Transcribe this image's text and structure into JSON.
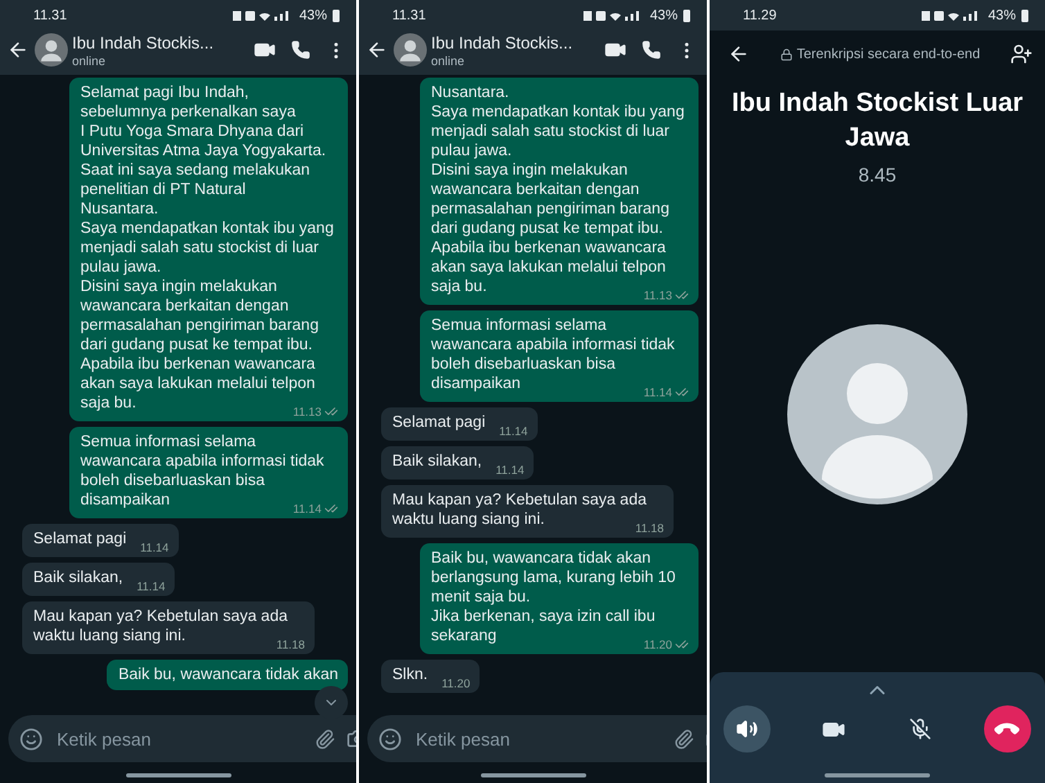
{
  "screens": [
    {
      "kind": "chat",
      "status_bar": {
        "time": "11.31",
        "battery": "43%"
      },
      "header": {
        "name": "Ibu Indah Stockis...",
        "status": "online"
      },
      "messages": [
        {
          "kind": "sent",
          "text": "Selamat pagi Ibu Indah,\nsebelumnya perkenalkan saya\nI Putu Yoga Smara Dhyana dari Universitas Atma Jaya Yogyakarta.\nSaat ini saya sedang melakukan penelitian di PT Natural\nNusantara.\nSaya mendapatkan kontak ibu yang menjadi salah satu stockist di luar pulau jawa.\nDisini saya ingin melakukan wawancara berkaitan dengan permasalahan pengiriman barang dari gudang pusat ke tempat ibu.\nApabila ibu berkenan wawancara akan saya lakukan melalui telpon saja bu.",
          "time": "11.13"
        },
        {
          "kind": "sent",
          "text": "Semua informasi selama wawancara apabila informasi tidak boleh disebarluaskan bisa disampaikan",
          "time": "11.14"
        },
        {
          "kind": "received",
          "text": "Selamat pagi",
          "time": "11.14"
        },
        {
          "kind": "received",
          "text": "Baik silakan,",
          "time": "11.14"
        },
        {
          "kind": "received",
          "text": "Mau kapan ya? Kebetulan saya ada waktu luang siang ini.",
          "time": "11.18"
        },
        {
          "kind": "sent",
          "text": "Baik bu, wawancara tidak akan"
        }
      ],
      "scroll_down_button": true,
      "composer": {
        "placeholder": "Ketik pesan"
      }
    },
    {
      "kind": "chat",
      "status_bar": {
        "time": "11.31",
        "battery": "43%"
      },
      "header": {
        "name": "Ibu Indah Stockis...",
        "status": "online"
      },
      "messages": [
        {
          "kind": "sent",
          "text": "Nusantara.\nSaya mendapatkan kontak ibu yang menjadi salah satu stockist di luar pulau jawa.\nDisini saya ingin melakukan wawancara berkaitan dengan permasalahan pengiriman barang dari gudang pusat ke tempat ibu.\nApabila ibu berkenan wawancara akan saya lakukan melalui telpon saja bu.",
          "time": "11.13"
        },
        {
          "kind": "sent",
          "text": "Semua informasi selama wawancara apabila informasi tidak boleh disebarluaskan bisa disampaikan",
          "time": "11.14"
        },
        {
          "kind": "received",
          "text": "Selamat pagi",
          "time": "11.14"
        },
        {
          "kind": "received",
          "text": "Baik silakan,",
          "time": "11.14"
        },
        {
          "kind": "received",
          "text": "Mau kapan ya? Kebetulan saya ada waktu luang siang ini.",
          "time": "11.18"
        },
        {
          "kind": "sent",
          "text": "Baik bu, wawancara tidak akan berlangsung lama, kurang lebih 10 menit saja bu.\nJika berkenan, saya izin call ibu sekarang",
          "time": "11.20"
        },
        {
          "kind": "received",
          "text": "Slkn.",
          "time": "11.20"
        }
      ],
      "scroll_down_button": false,
      "composer": {
        "placeholder": "Ketik pesan"
      }
    },
    {
      "kind": "call",
      "status_bar": {
        "time": "11.29",
        "battery": "43%"
      },
      "encryption": "Terenkripsi secara end-to-end",
      "name": "Ibu Indah Stockist Luar Jawa",
      "duration": "8.45",
      "controls": [
        {
          "kind": "speaker",
          "on": true
        },
        {
          "kind": "video",
          "on": false
        },
        {
          "kind": "mute",
          "on": false
        },
        {
          "kind": "end"
        }
      ]
    }
  ]
}
